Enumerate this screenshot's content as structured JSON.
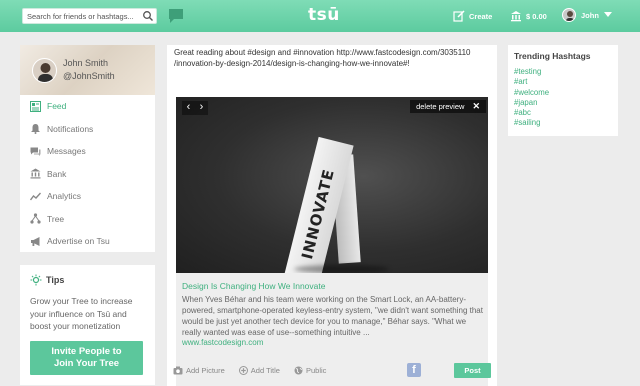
{
  "topbar": {
    "search_placeholder": "Search for friends or hashtags...",
    "logo": "tsū",
    "create_label": "Create",
    "bank_label": "$ 0.00",
    "user_label": "John"
  },
  "profile": {
    "name": "John Smith",
    "handle": "@JohnSmith"
  },
  "menu": {
    "items": [
      {
        "label": "Feed"
      },
      {
        "label": "Notifications"
      },
      {
        "label": "Messages"
      },
      {
        "label": "Bank"
      },
      {
        "label": "Analytics"
      },
      {
        "label": "Tree"
      },
      {
        "label": "Advertise on Tsu"
      }
    ]
  },
  "tips": {
    "title": "Tips",
    "text": "Grow your Tree to increase your influence on Tsū and boost your monetization",
    "button_line1": "Invite People to",
    "button_line2": "Join Your Tree"
  },
  "composer": {
    "text_line1": "Great reading about #design and #innovation http://www.fastcodesign.com/3035110",
    "text_line2": "/innovation-by-design-2014/design-is-changing-how-we-innovate#!",
    "preview": {
      "image_word": "INNOVATE",
      "prev_label": "‹",
      "next_label": "›",
      "delete_label": "delete preview",
      "close_label": "✕",
      "title": "Design Is Changing How We Innovate",
      "description": "When Yves Béhar and his team were working on the Smart Lock, an AA-battery-powered, smartphone-operated keyless-entry system, \"we didn't want something that would be just yet another tech device for you to manage,\" Béhar says. \"What we really wanted was ease of use--something intuitive ...",
      "url": "www.fastcodesign.com"
    },
    "actions": {
      "add_picture": "Add Picture",
      "add_title": "Add Title",
      "public": "Public",
      "facebook": "f",
      "post": "Post"
    }
  },
  "trending": {
    "title": "Trending Hashtags",
    "tags": [
      "#testing",
      "#art",
      "#welcome",
      "#japan",
      "#abc",
      "#sailing"
    ]
  },
  "colors": {
    "accent": "#5cc79c",
    "link": "#3fb07f",
    "topbar_top": "#7fdcb6",
    "topbar_bottom": "#5ccb9f"
  }
}
